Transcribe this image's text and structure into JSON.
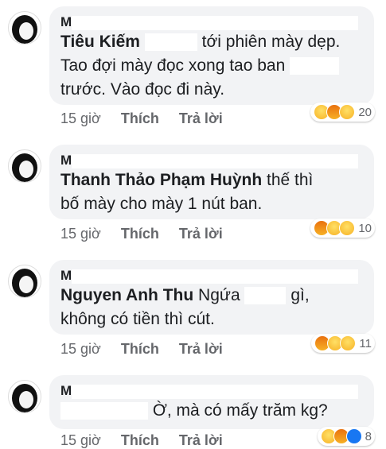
{
  "comments": [
    {
      "author_initial": "M",
      "name": "Tiêu Kiếm",
      "text_line1": "tới phiên mày dẹp.",
      "text_line2_a": "Tao đợi mày đọc xong tao ban",
      "text_line3": "trước. Vào đọc đi này.",
      "time": "15 giờ",
      "like": "Thích",
      "reply": "Trả lời",
      "reactions": [
        "haha-icon",
        "angry-icon",
        "wow-icon"
      ],
      "reaction_count": "20"
    },
    {
      "author_initial": "M",
      "name": "Thanh Thảo Phạm Huỳnh",
      "text_line1": "thế thì",
      "text_line2": "bố mày cho mày 1 nút ban.",
      "time": "15 giờ",
      "like": "Thích",
      "reply": "Trả lời",
      "reactions": [
        "angry-icon",
        "haha-icon",
        "wow-icon"
      ],
      "reaction_count": "10"
    },
    {
      "author_initial": "M",
      "name": "Nguyen Anh Thu",
      "text_line1_a": "Ngứa",
      "text_line1_b": "gì,",
      "text_line2": "không có tiền thì cút.",
      "time": "15 giờ",
      "like": "Thích",
      "reply": "Trả lời",
      "reactions": [
        "angry-icon",
        "wow-icon",
        "haha-icon"
      ],
      "reaction_count": "11"
    },
    {
      "author_initial": "M",
      "text_line1": "Ờ, mà có mấy trăm kg?",
      "time": "15 giờ",
      "like": "Thích",
      "reply": "Trả lời",
      "reactions": [
        "haha-icon",
        "angry-icon",
        "like-icon"
      ],
      "reaction_count": "8"
    }
  ],
  "colors": {
    "bubble": "#f2f3f5",
    "text": "#1c1e21",
    "meta": "#65676b"
  }
}
